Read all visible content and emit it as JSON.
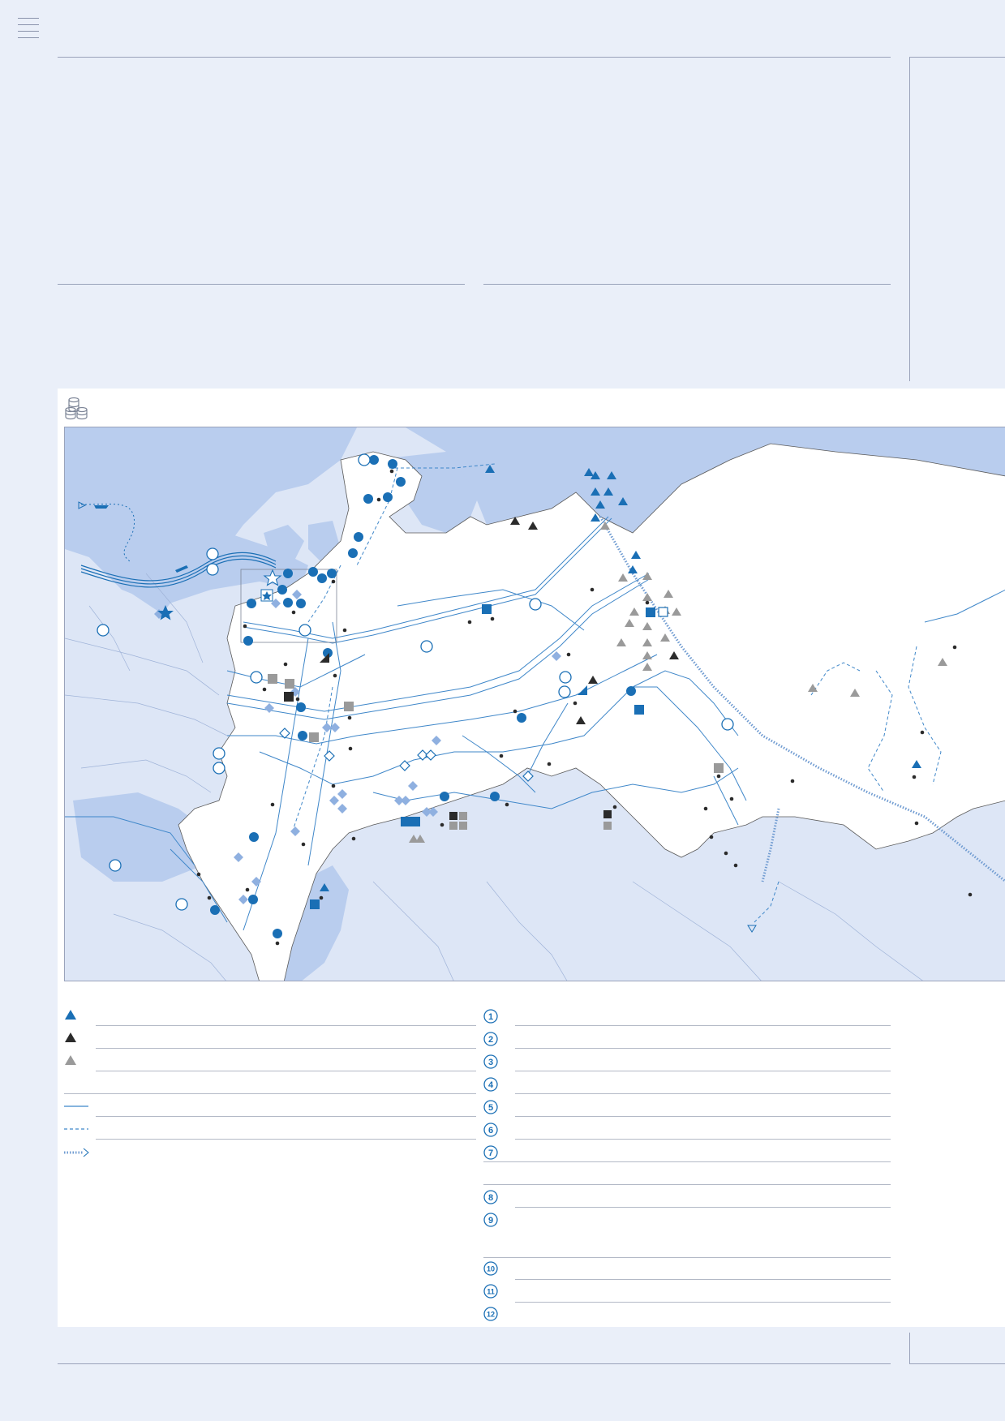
{
  "header": {
    "menu_icon": "hamburger-menu-icon"
  },
  "map": {
    "icon": "database-stack-icon",
    "colors": {
      "sea": "#b9cdee",
      "foreign_land": "#dde6f6",
      "land": "#ffffff",
      "accent_blue": "#1a6fb5",
      "light_blue": "#8fb0e0",
      "dark": "#2b2b2b",
      "grey": "#9a9a9a",
      "border_line": "#9aa3bb"
    }
  },
  "legend_left": {
    "rows": [
      {
        "symbol": "triangle-blue-icon"
      },
      {
        "symbol": "triangle-black-icon"
      },
      {
        "symbol": "triangle-grey-icon"
      },
      {
        "symbol": "none"
      },
      {
        "symbol": "pipeline-solid-icon"
      },
      {
        "symbol": "pipeline-dashed-icon"
      },
      {
        "symbol": "pipeline-dotted-arrow-icon"
      }
    ]
  },
  "legend_right": {
    "rows": [
      {
        "number": "1"
      },
      {
        "number": "2"
      },
      {
        "number": "3"
      },
      {
        "number": "4"
      },
      {
        "number": "5"
      },
      {
        "number": "6"
      },
      {
        "number": "7"
      },
      {
        "number": ""
      },
      {
        "number": "8"
      },
      {
        "number": "9"
      },
      {
        "number": "10"
      },
      {
        "number": "11"
      },
      {
        "number": "12"
      }
    ]
  }
}
